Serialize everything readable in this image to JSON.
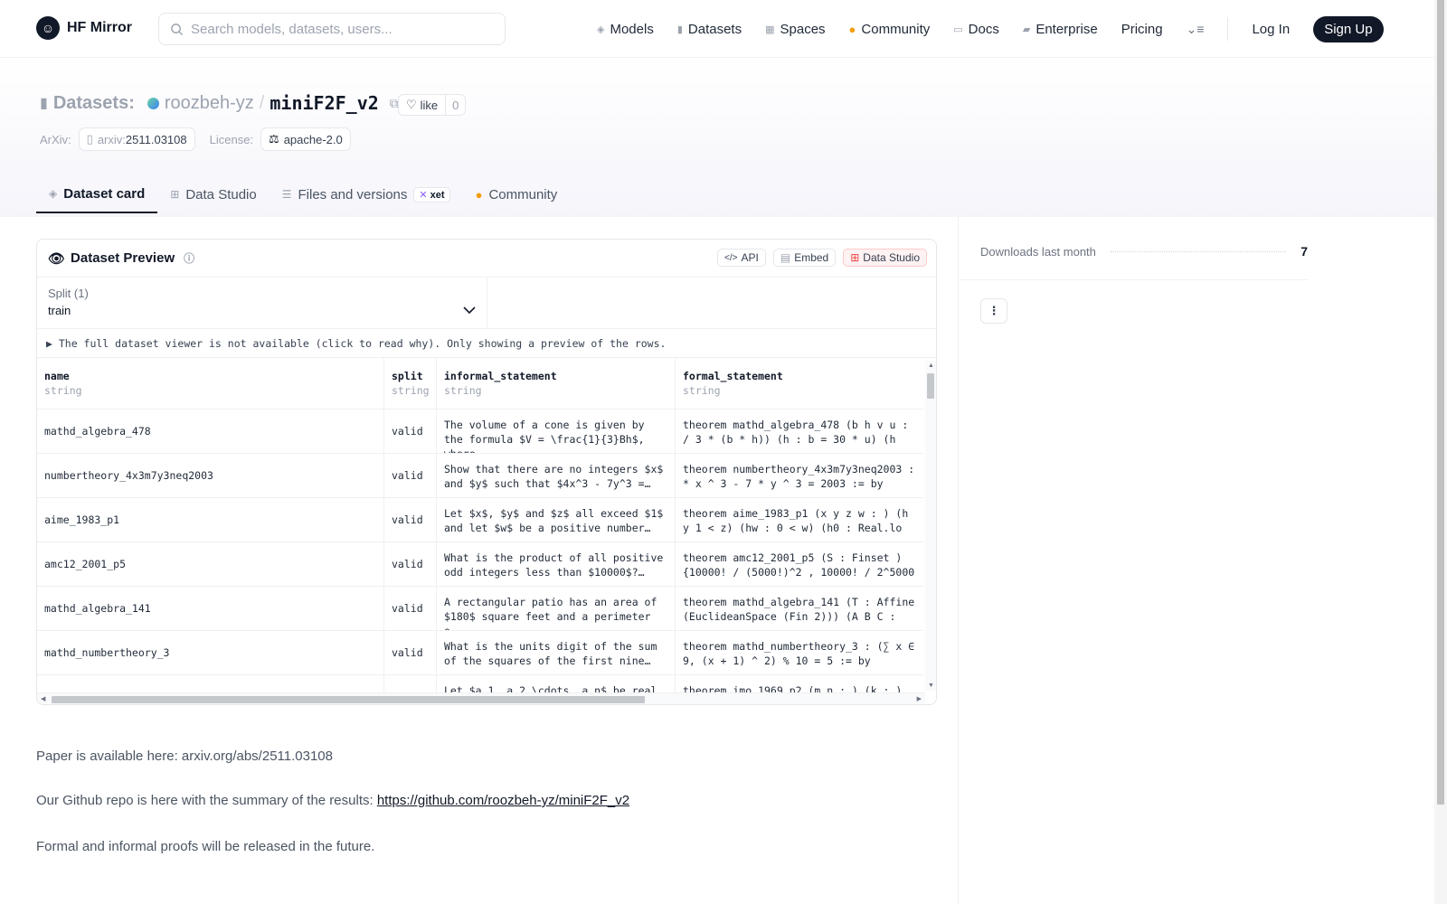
{
  "header": {
    "logo_text": "HF Mirror",
    "search_placeholder": "Search models, datasets, users...",
    "nav": [
      {
        "label": "Models",
        "icon": "cube-icon"
      },
      {
        "label": "Datasets",
        "icon": "database-icon"
      },
      {
        "label": "Spaces",
        "icon": "grid-icon"
      },
      {
        "label": "Community",
        "icon": "chat-icon"
      },
      {
        "label": "Docs",
        "icon": "book-icon"
      },
      {
        "label": "Enterprise",
        "icon": "building-icon"
      },
      {
        "label": "Pricing"
      }
    ],
    "login": "Log In",
    "signup": "Sign Up"
  },
  "repo": {
    "type_label": "Datasets:",
    "owner": "roozbeh-yz",
    "slash": "/",
    "name": "miniF2F_v2",
    "like_label": "like",
    "like_count": "0",
    "arxiv_label": "ArXiv:",
    "arxiv_prefix": "arxiv:",
    "arxiv_id": "2511.03108",
    "license_label": "License:",
    "license": "apache-2.0"
  },
  "tabs": [
    {
      "label": "Dataset card",
      "active": true
    },
    {
      "label": "Data Studio"
    },
    {
      "label": "Files and versions",
      "badge": "xet"
    },
    {
      "label": "Community"
    }
  ],
  "preview": {
    "title": "Dataset Preview",
    "buttons": {
      "api": "API",
      "embed": "Embed",
      "studio": "Data Studio"
    },
    "split_label": "Split (1)",
    "split_value": "train",
    "notice": "▶ The full dataset viewer is not available (click to read why). Only showing a preview of the rows.",
    "columns": [
      {
        "name": "name",
        "type": "string"
      },
      {
        "name": "split",
        "type": "string"
      },
      {
        "name": "informal_statement",
        "type": "string"
      },
      {
        "name": "formal_statement",
        "type": "string"
      }
    ],
    "rows": [
      {
        "name": "mathd_algebra_478",
        "split": "valid",
        "informal": "The volume of a cone is given by the formula $V = \\frac{1}{3}Bh$, where…",
        "formal": "theorem mathd_algebra_478 (b h v u : / 3 * (b * h)) (h : b = 30 * u) (h"
      },
      {
        "name": "numbertheory_4x3m7y3neq2003",
        "split": "valid",
        "informal": "Show that there are no integers $x$ and $y$ such that $4x^3 - 7y^3 =…",
        "formal": "theorem numbertheory_4x3m7y3neq2003 : * x ^ 3 - 7 * y ^ 3 = 2003 := by"
      },
      {
        "name": "aime_1983_p1",
        "split": "valid",
        "informal": "Let $x$, $y$ and $z$ all exceed $1$ and let $w$ be a positive number…",
        "formal": "theorem aime_1983_p1 (x y z w : ) (h y  1 < z) (hw : 0 < w) (h0 : Real.lo"
      },
      {
        "name": "amc12_2001_p5",
        "split": "valid",
        "informal": "What is the product of all positive odd integers less than $10000$?…",
        "formal": "theorem amc12_2001_p5 (S : Finset ) {10000! / (5000!)^2 , 10000! / 2^5000"
      },
      {
        "name": "mathd_algebra_141",
        "split": "valid",
        "informal": "A rectangular patio has an area of $180$ square feet and a perimeter o…",
        "formal": "theorem mathd_algebra_141 (T : Affine (EuclideanSpace  (Fin 2))) (A B C :"
      },
      {
        "name": "mathd_numbertheory_3",
        "split": "valid",
        "informal": "What is the units digit of the sum of the squares of the first nine…",
        "formal": "theorem mathd_numbertheory_3 : (∑ x ∈ 9, (x + 1) ^ 2) % 10 = 5 := by"
      },
      {
        "name": "",
        "split": "",
        "informal": "Let $a_1, a_2,\\cdots, a_n$ be real",
        "formal": "theorem imo_1969_p2 (m n : ) (k : )"
      }
    ]
  },
  "body": {
    "p1": "Paper is available here: arxiv.org/abs/2511.03108",
    "p2_prefix": "Our Github repo is here with the summary of the results: ",
    "p2_link": "https://github.com/roozbeh-yz/miniF2F_v2",
    "p3": "Formal and informal proofs will be released in the future."
  },
  "sidebar": {
    "downloads_label": "Downloads last month",
    "downloads_value": "7"
  }
}
